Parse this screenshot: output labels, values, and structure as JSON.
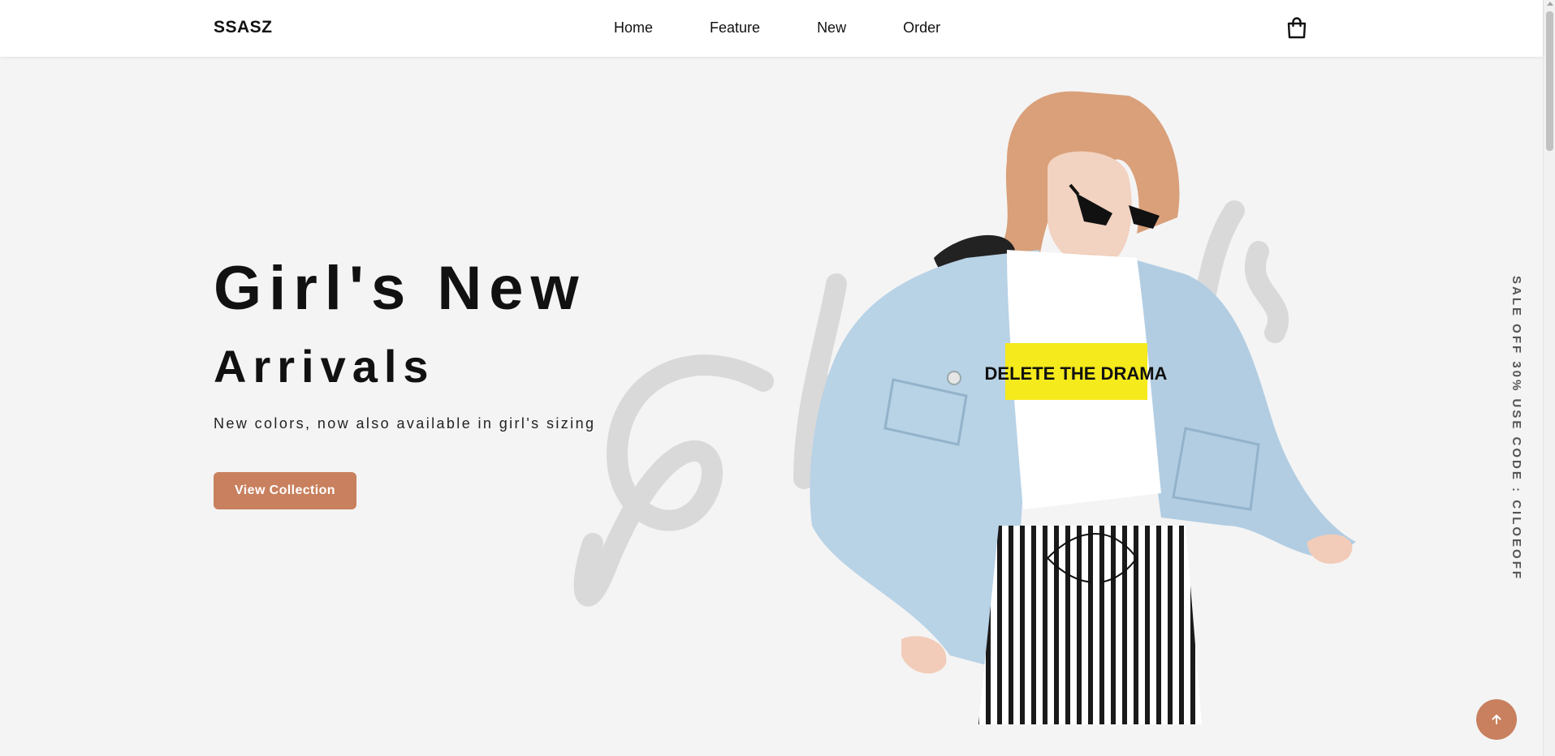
{
  "header": {
    "logo": "SSASZ",
    "nav": [
      "Home",
      "Feature",
      "New",
      "Order"
    ],
    "cart_icon": "shopping-bag-icon"
  },
  "hero": {
    "title_line1": "Girl's New",
    "title_line2": "Arrivals",
    "subtitle": "New colors, now also available in girl's sizing",
    "cta_label": "View Collection",
    "shirt_text": "DELETE THE DRAMA"
  },
  "side_banner": "SALE OFF 30% USE CODE : CILOEOFF",
  "scroll_top_icon": "arrow-up-icon",
  "colors": {
    "accent": "#c8805e",
    "background": "#f4f4f4",
    "header_bg": "#ffffff",
    "text": "#111111"
  }
}
